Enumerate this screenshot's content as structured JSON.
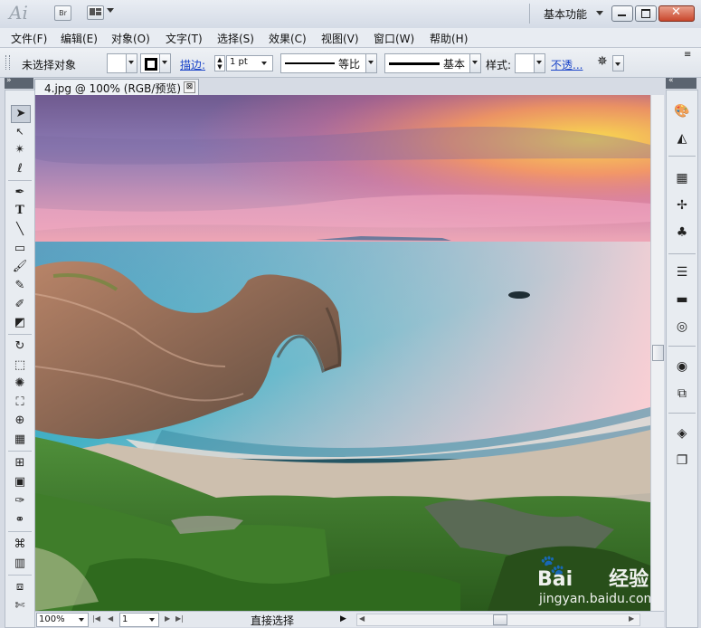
{
  "app": {
    "logo": "Ai",
    "bridge_label": "Br",
    "workspace": "基本功能"
  },
  "menu": [
    "文件(F)",
    "编辑(E)",
    "对象(O)",
    "文字(T)",
    "选择(S)",
    "效果(C)",
    "视图(V)",
    "窗口(W)",
    "帮助(H)"
  ],
  "control": {
    "selection_status": "未选择对象",
    "stroke_label": "描边:",
    "stroke_weight": "1 pt",
    "stroke_profile": "等比",
    "brush": "基本",
    "style_label": "样式:",
    "opacity_link": "不透..."
  },
  "document": {
    "tab_title": "4.jpg @ 100% (RGB/预览)",
    "close_glyph": "⊠"
  },
  "status": {
    "zoom": "100%",
    "artboard": "1",
    "tool": "直接选择"
  },
  "watermark": {
    "brand": "Bai",
    "brand_cn": "经验",
    "url": "jingyan.baidu.com"
  },
  "colors": {
    "chrome": "#d6dbe4",
    "link": "#1a44c8",
    "close_red": "#c9472c"
  },
  "tools": [
    "selection-tool",
    "direct-selection-tool",
    "magic-wand-tool",
    "lasso-tool",
    "pen-tool",
    "type-tool",
    "line-tool",
    "rectangle-tool",
    "paintbrush-tool",
    "pencil-tool",
    "blob-brush-tool",
    "eraser-tool",
    "rotate-tool",
    "scale-tool",
    "warp-tool",
    "free-transform-tool",
    "shape-builder-tool",
    "perspective-grid-tool",
    "mesh-tool",
    "gradient-tool",
    "eyedropper-tool",
    "blend-tool",
    "symbol-sprayer-tool",
    "column-graph-tool",
    "artboard-tool",
    "slice-tool"
  ],
  "right_panels": [
    "color-icon",
    "color-guide-icon",
    "swatches-icon",
    "brushes-icon",
    "symbols-icon",
    "stroke-icon",
    "gradient-icon",
    "transparency-icon",
    "appearance-icon",
    "graphic-styles-icon",
    "layers-icon",
    "artboards-icon"
  ]
}
